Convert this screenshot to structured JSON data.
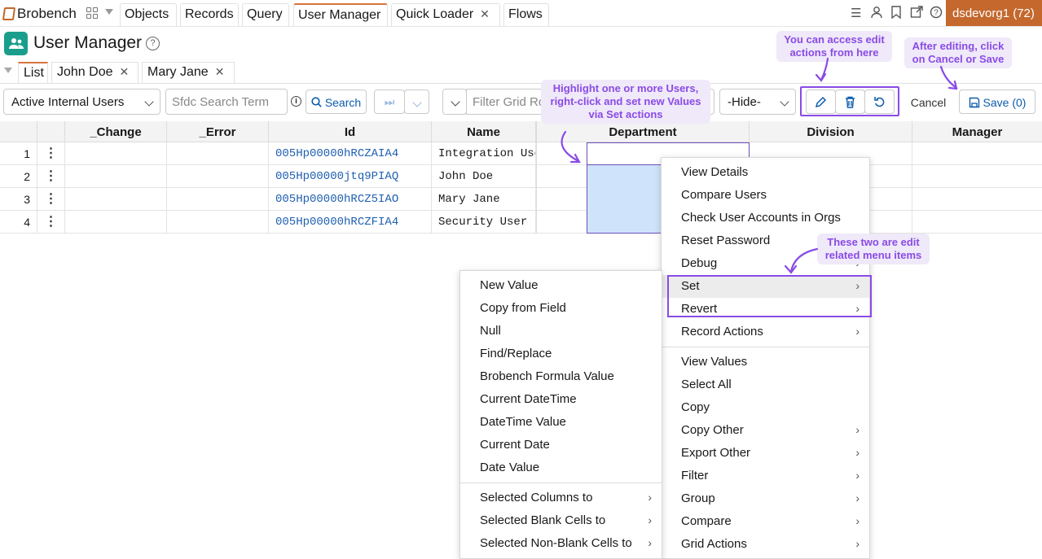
{
  "app": {
    "brand": "Brobench",
    "nav_tabs": [
      {
        "label": "Objects"
      },
      {
        "label": "Records"
      },
      {
        "label": "Query"
      },
      {
        "label": "User Manager"
      },
      {
        "label": "Quick Loader"
      },
      {
        "label": "Flows"
      }
    ],
    "org_badge": "dsdevorg1 (72)"
  },
  "page": {
    "title": "User Manager",
    "sub_tabs": [
      {
        "label": "List"
      },
      {
        "label": "John Doe"
      },
      {
        "label": "Mary Jane"
      }
    ]
  },
  "toolbar": {
    "view_select": "Active Internal Users",
    "search_placeholder": "Sfdc Search Term",
    "search_button": "Search",
    "filter_placeholder": "Filter Grid Rows",
    "hide_select": "-Hide-",
    "cancel": "Cancel",
    "save": "Save (0)"
  },
  "grid": {
    "columns": [
      "_Change",
      "_Error",
      "Id",
      "Name",
      "Department",
      "Division",
      "Manager"
    ],
    "rows": [
      {
        "num": "1",
        "id": "005Hp00000hRCZAIA4",
        "name": "Integration User"
      },
      {
        "num": "2",
        "id": "005Hp00000jtq9PIAQ",
        "name": "John Doe"
      },
      {
        "num": "3",
        "id": "005Hp00000hRCZ5IAO",
        "name": "Mary Jane"
      },
      {
        "num": "4",
        "id": "005Hp00000hRCZFIA4",
        "name": "Security User"
      }
    ]
  },
  "context_menu": {
    "group1": [
      "View Details",
      "Compare Users",
      "Check User Accounts in Orgs",
      "Reset Password"
    ],
    "debug": "Debug",
    "set": "Set",
    "revert": "Revert",
    "record_actions": "Record Actions",
    "group2": [
      "View Values",
      "Select All",
      "Copy"
    ],
    "group3": [
      "Copy Other",
      "Export Other",
      "Filter",
      "Group",
      "Compare",
      "Grid Actions"
    ]
  },
  "set_submenu": {
    "group1": [
      "New Value",
      "Copy from Field",
      "Null",
      "Find/Replace",
      "Brobench Formula Value",
      "Current DateTime",
      "DateTime Value",
      "Current Date",
      "Date Value"
    ],
    "group2": [
      "Selected Columns to",
      "Selected Blank Cells to",
      "Selected Non-Blank Cells to"
    ]
  },
  "callouts": {
    "edit_actions": "You can access edit actions from here",
    "cancel_save": "After editing, click on Cancel or Save",
    "highlight": "Highlight one or more Users, right-click and set new Values via Set actions",
    "menu_items": "These two are edit related menu items"
  },
  "colors": {
    "accent_orange": "#c4682e",
    "callout_purple": "#8a4be6",
    "callout_bg": "#efe9f9",
    "link_blue": "#1f5fb0",
    "selection_blue": "#cfe3fb"
  }
}
